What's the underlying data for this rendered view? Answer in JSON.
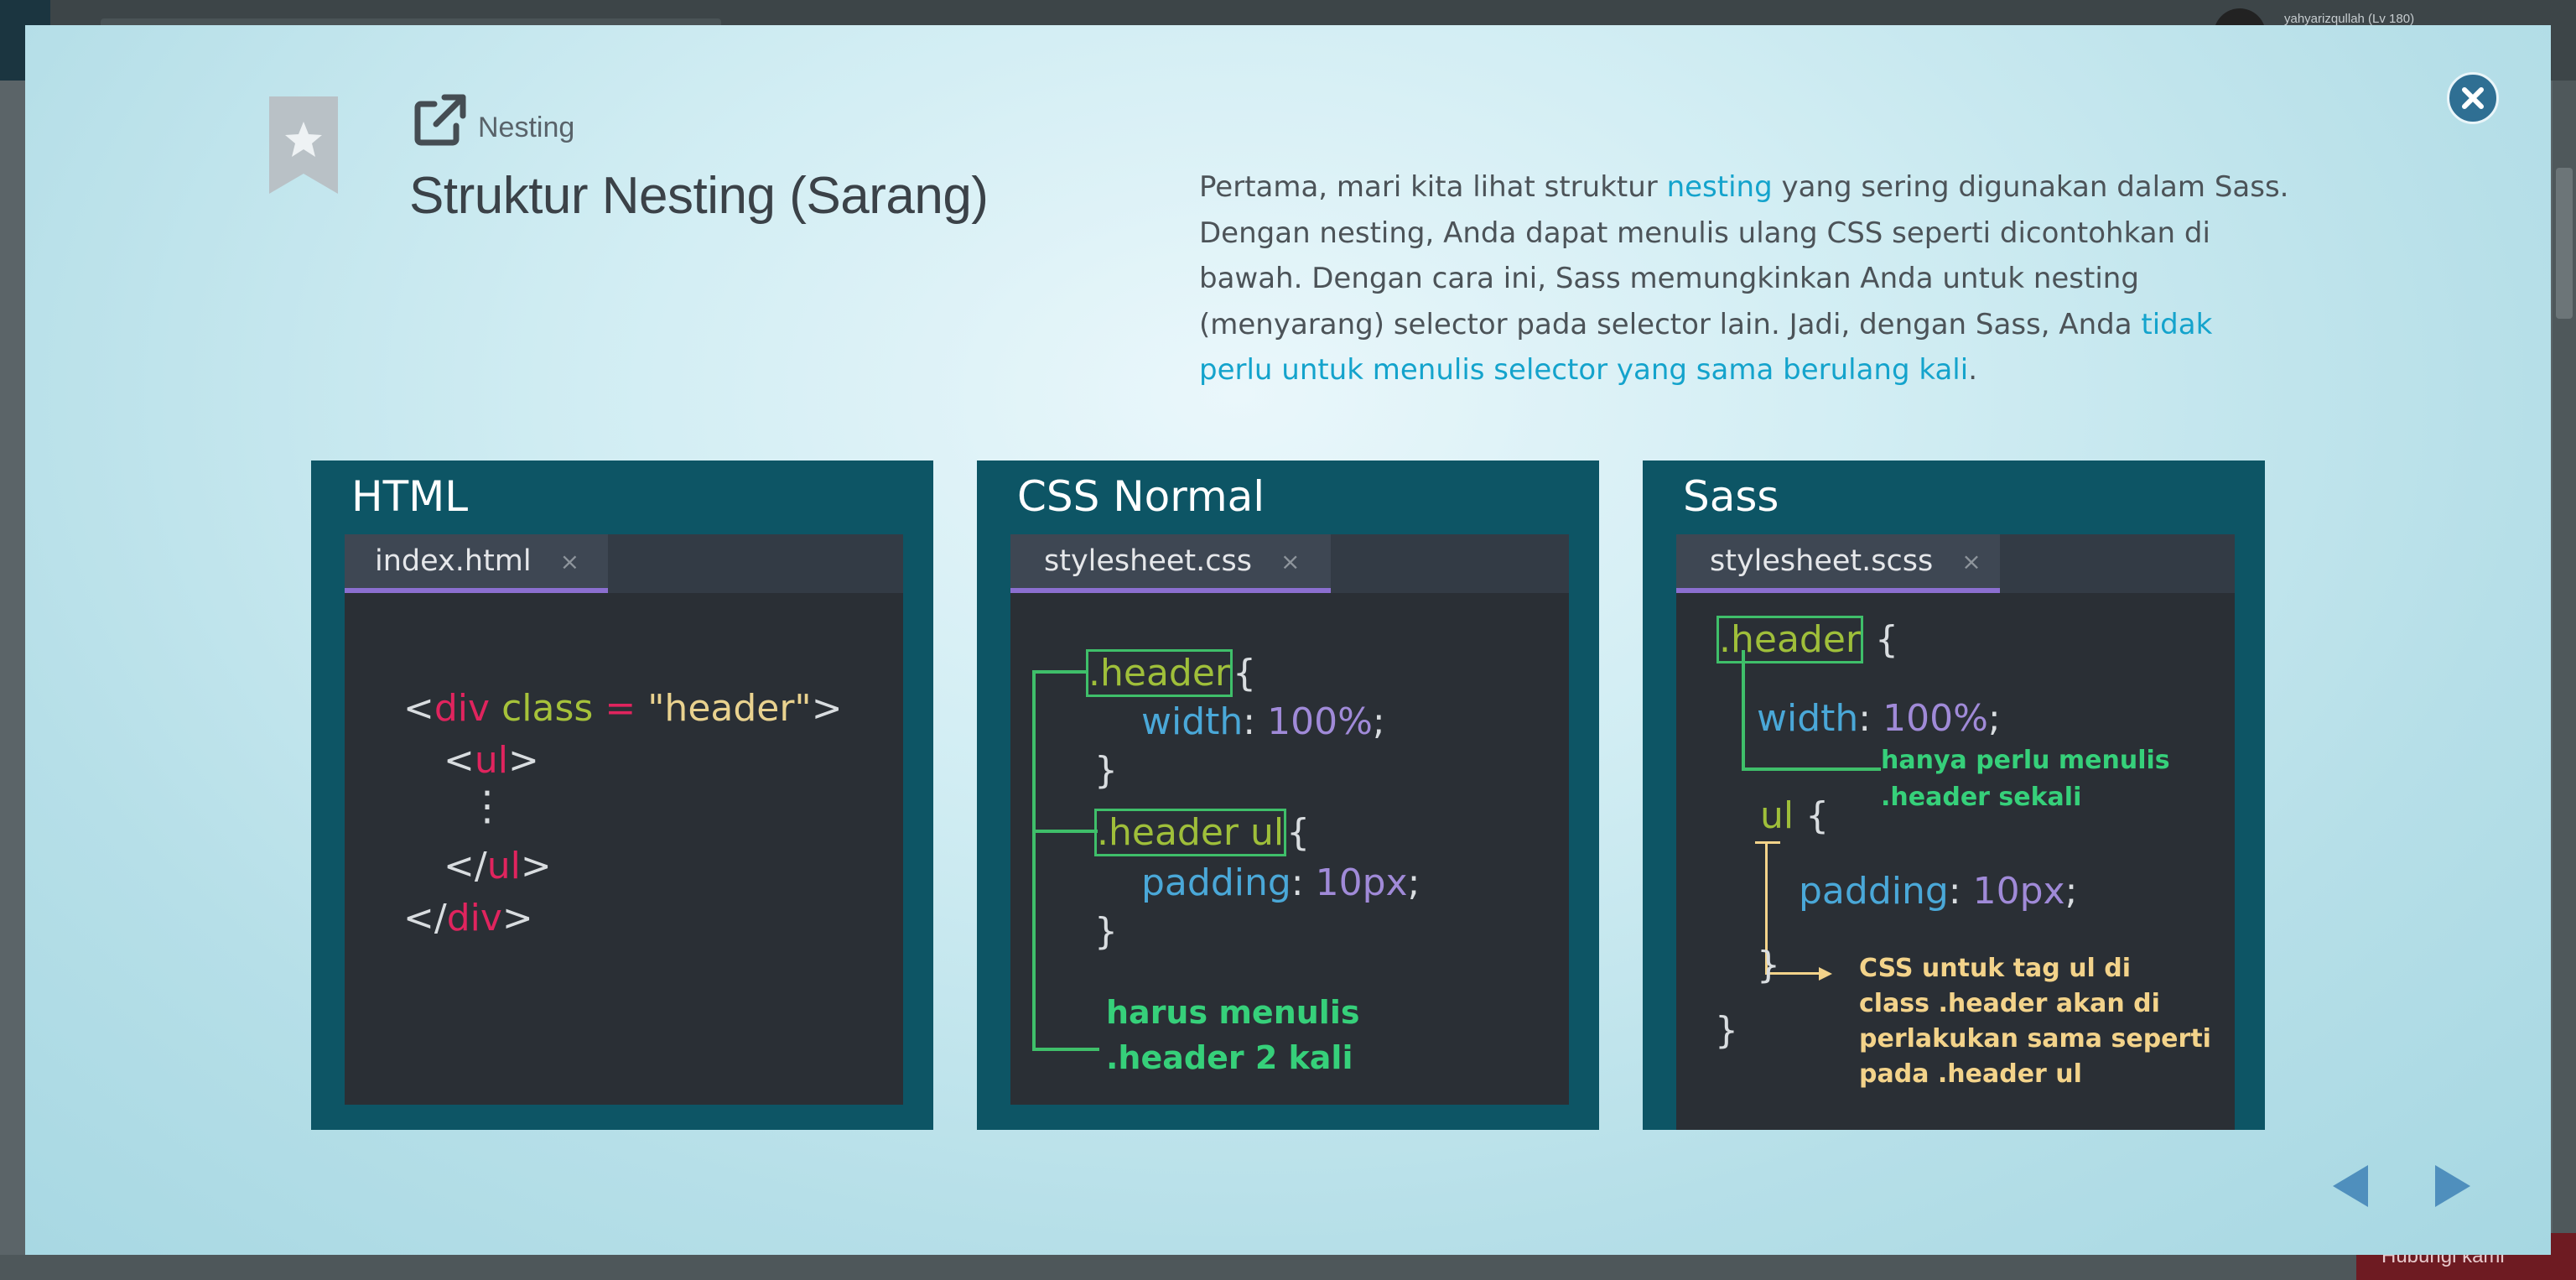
{
  "background": {
    "username": "yahyarizqullah (Lv 180)",
    "bottom_button": "Hubungi kami"
  },
  "modal": {
    "header_label": "Nesting",
    "title": "Struktur Nesting (Sarang)",
    "description": {
      "p1": "Pertama, mari kita lihat struktur ",
      "hl1": "nesting",
      "p2": " yang sering digunakan dalam Sass. Dengan nesting, Anda dapat menulis ulang CSS seperti dicontohkan di bawah. Dengan cara ini, Sass memungkinkan Anda untuk nesting (menyarang) selector pada selector lain. Jadi, dengan Sass, Anda ",
      "hl2": "tidak perlu untuk menulis selector yang sama berulang kali",
      "p3": "."
    },
    "panels": {
      "html": {
        "title": "HTML",
        "tab": "index.html",
        "tab_close": "×",
        "lt": "<",
        "gt": ">",
        "lt_slash": "</",
        "div": "div",
        "class": "class",
        "eq": "=",
        "str": "\"header\"",
        "ul": "ul",
        "vdots": "⋮"
      },
      "css": {
        "title": "CSS Normal",
        "tab": "stylesheet.css",
        "tab_close": "×",
        "sel1": ".header",
        "sel2": ".header ul",
        "open": "{",
        "close": "}",
        "prop1": "width",
        "val1": "100%",
        "prop2": "padding",
        "val2": "10px",
        "colon": ":",
        "semi": ";",
        "note_line1": "harus menulis",
        "note_line2": ".header 2 kali"
      },
      "sass": {
        "title": "Sass",
        "tab": "stylesheet.scss",
        "tab_close": "×",
        "sel1": ".header",
        "sel2": "ul",
        "open": "{",
        "close": "}",
        "prop1": "width",
        "val1": "100%",
        "prop2": "padding",
        "val2": "10px",
        "colon": ":",
        "semi": ";",
        "note_green_1": "hanya perlu menulis",
        "note_green_2": ".header sekali",
        "note_yellow_1": "CSS untuk tag ul di",
        "note_yellow_2": "class .header akan di",
        "note_yellow_3": "perlakukan sama seperti",
        "note_yellow_4": "pada .header ul"
      }
    }
  },
  "icons": {
    "bookmark": "star-bookmark-icon",
    "external": "external-link-icon",
    "close": "close-circle-icon",
    "prev": "prev-arrow-icon",
    "next": "next-arrow-icon"
  },
  "colors": {
    "panel_bg": "#0d5565",
    "editor_bg": "#2a2f35",
    "highlight": "#14a3cc",
    "close_button": "#2f6f93",
    "nav_arrow": "#4f8fbd"
  }
}
